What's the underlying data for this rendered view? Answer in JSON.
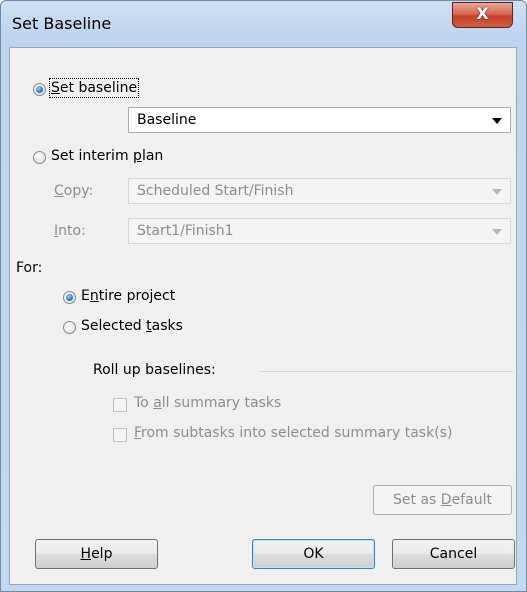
{
  "window": {
    "title": "Set Baseline",
    "close_glyph": "X"
  },
  "set_baseline": {
    "radio_label_u": "S",
    "radio_label_rest": "et baseline",
    "selected": true,
    "combo_value": "Baseline"
  },
  "interim_plan": {
    "radio_label_a": "Set interim ",
    "radio_label_u": "p",
    "radio_label_rest": "lan",
    "selected": false,
    "copy_label_u": "C",
    "copy_label_rest": "opy:",
    "copy_value": "Scheduled Start/Finish",
    "into_label_u": "I",
    "into_label_rest": "nto:",
    "into_value": "Start1/Finish1"
  },
  "for_section": {
    "label": "For:",
    "entire_project_u1": "E",
    "entire_project_u2": "n",
    "entire_project_rest": "tire project",
    "entire_selected": true,
    "selected_tasks_a": "Selected ",
    "selected_tasks_u": "t",
    "selected_tasks_rest": "asks"
  },
  "rollup": {
    "label": "Roll up baselines:",
    "to_all_a": "To ",
    "to_all_u": "a",
    "to_all_rest": "ll summary tasks",
    "from_sub_u": "F",
    "from_sub_rest": "rom subtasks into selected summary task(s)"
  },
  "buttons": {
    "set_default_a": "Set as ",
    "set_default_u": "D",
    "set_default_rest": "efault",
    "help_u": "H",
    "help_rest": "elp",
    "ok": "OK",
    "cancel": "Cancel"
  }
}
